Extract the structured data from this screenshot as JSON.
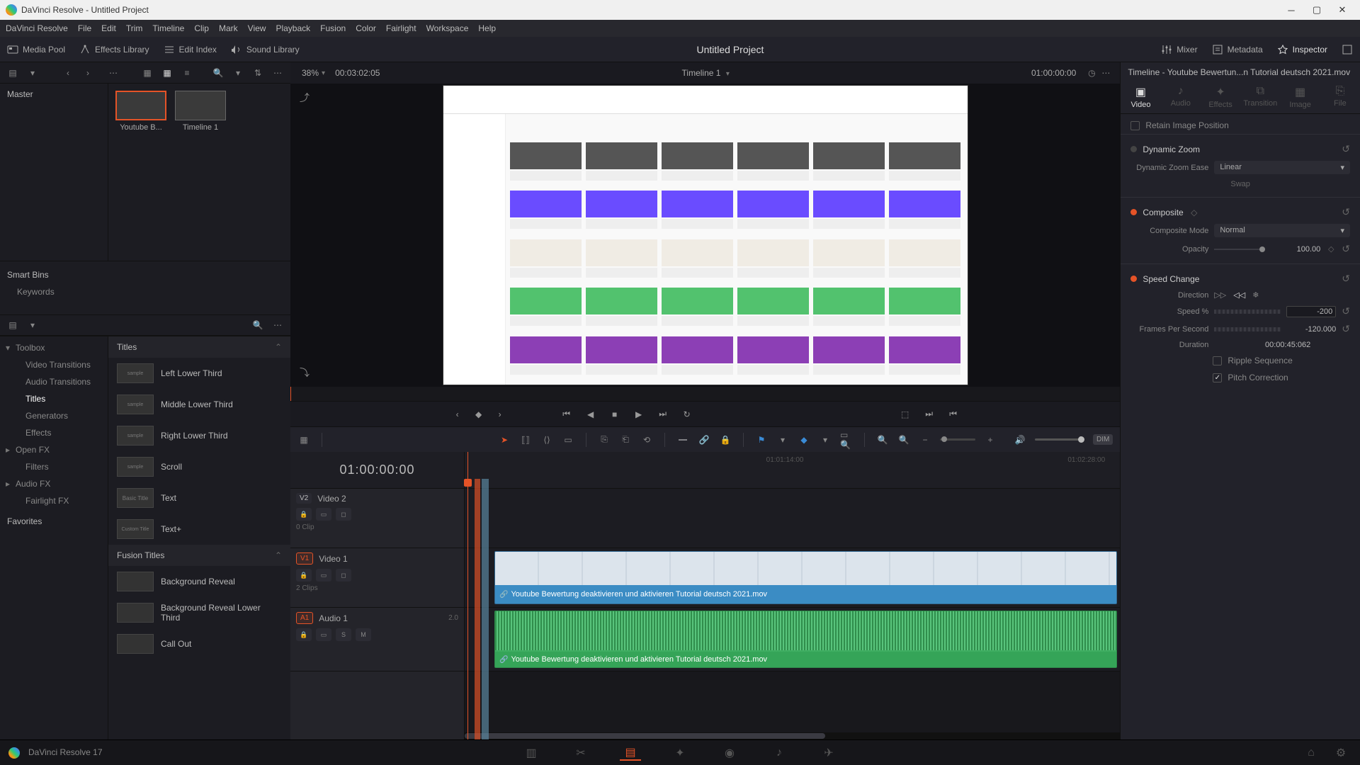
{
  "window": {
    "title": "DaVinci Resolve - Untitled Project"
  },
  "menubar": [
    "DaVinci Resolve",
    "File",
    "Edit",
    "Trim",
    "Timeline",
    "Clip",
    "Mark",
    "View",
    "Playback",
    "Fusion",
    "Color",
    "Fairlight",
    "Workspace",
    "Help"
  ],
  "toptoolbar": {
    "media_pool": "Media Pool",
    "effects_library": "Effects Library",
    "edit_index": "Edit Index",
    "sound_library": "Sound Library",
    "project": "Untitled Project",
    "mixer": "Mixer",
    "metadata": "Metadata",
    "inspector": "Inspector"
  },
  "media": {
    "master": "Master",
    "smart_bins": "Smart Bins",
    "keywords": "Keywords",
    "thumbs": [
      {
        "label": "Youtube B..."
      },
      {
        "label": "Timeline 1"
      }
    ]
  },
  "fx_tree": {
    "toolbox": "Toolbox",
    "video_transitions": "Video Transitions",
    "audio_transitions": "Audio Transitions",
    "titles": "Titles",
    "generators": "Generators",
    "effects": "Effects",
    "open_fx": "Open FX",
    "filters": "Filters",
    "audio_fx": "Audio FX",
    "fairlight_fx": "Fairlight FX",
    "favorites": "Favorites"
  },
  "fx_list": {
    "titles_hdr": "Titles",
    "fusion_hdr": "Fusion Titles",
    "items_titles": [
      "Left Lower Third",
      "Middle Lower Third",
      "Right Lower Third",
      "Scroll",
      "Text",
      "Text+"
    ],
    "items_fusion": [
      "Background Reveal",
      "Background Reveal Lower Third",
      "Call Out"
    ]
  },
  "viewer": {
    "zoom": "38%",
    "source_tc": "00:03:02:05",
    "timeline_name": "Timeline 1",
    "rec_tc": "01:00:00:00"
  },
  "tl_toolbar": {
    "dim": "DIM"
  },
  "ruler": {
    "t0": "",
    "t1": "01:01:14:00",
    "t2": "01:02:28:00"
  },
  "timeline": {
    "tc": "01:00:00:00",
    "v2": {
      "id": "V2",
      "name": "Video 2",
      "clips": "0 Clip"
    },
    "v1": {
      "id": "V1",
      "name": "Video 1",
      "clips": "2 Clips"
    },
    "a1": {
      "id": "A1",
      "name": "Audio 1",
      "ch": "2.0",
      "s": "S",
      "m": "M"
    },
    "clip_name": "Youtube Bewertung deaktivieren und aktivieren Tutorial deutsch 2021.mov"
  },
  "inspector": {
    "title": "Timeline - Youtube Bewertun...n Tutorial deutsch 2021.mov",
    "tabs": {
      "video": "Video",
      "audio": "Audio",
      "effects": "Effects",
      "transition": "Transition",
      "image": "Image",
      "file": "File"
    },
    "retain": "Retain Image Position",
    "dynamic_zoom": {
      "label": "Dynamic Zoom",
      "ease_label": "Dynamic Zoom Ease",
      "ease_value": "Linear",
      "swap": "Swap"
    },
    "composite": {
      "label": "Composite",
      "mode_label": "Composite Mode",
      "mode_value": "Normal",
      "opacity_label": "Opacity",
      "opacity_value": "100.00"
    },
    "speed": {
      "label": "Speed Change",
      "direction_label": "Direction",
      "speed_label": "Speed %",
      "speed_value": "-200",
      "fps_label": "Frames Per Second",
      "fps_value": "-120.000",
      "duration_label": "Duration",
      "duration_value": "00:00:45:062",
      "ripple": "Ripple Sequence",
      "pitch": "Pitch Correction"
    }
  },
  "footer_version": "DaVinci Resolve 17"
}
